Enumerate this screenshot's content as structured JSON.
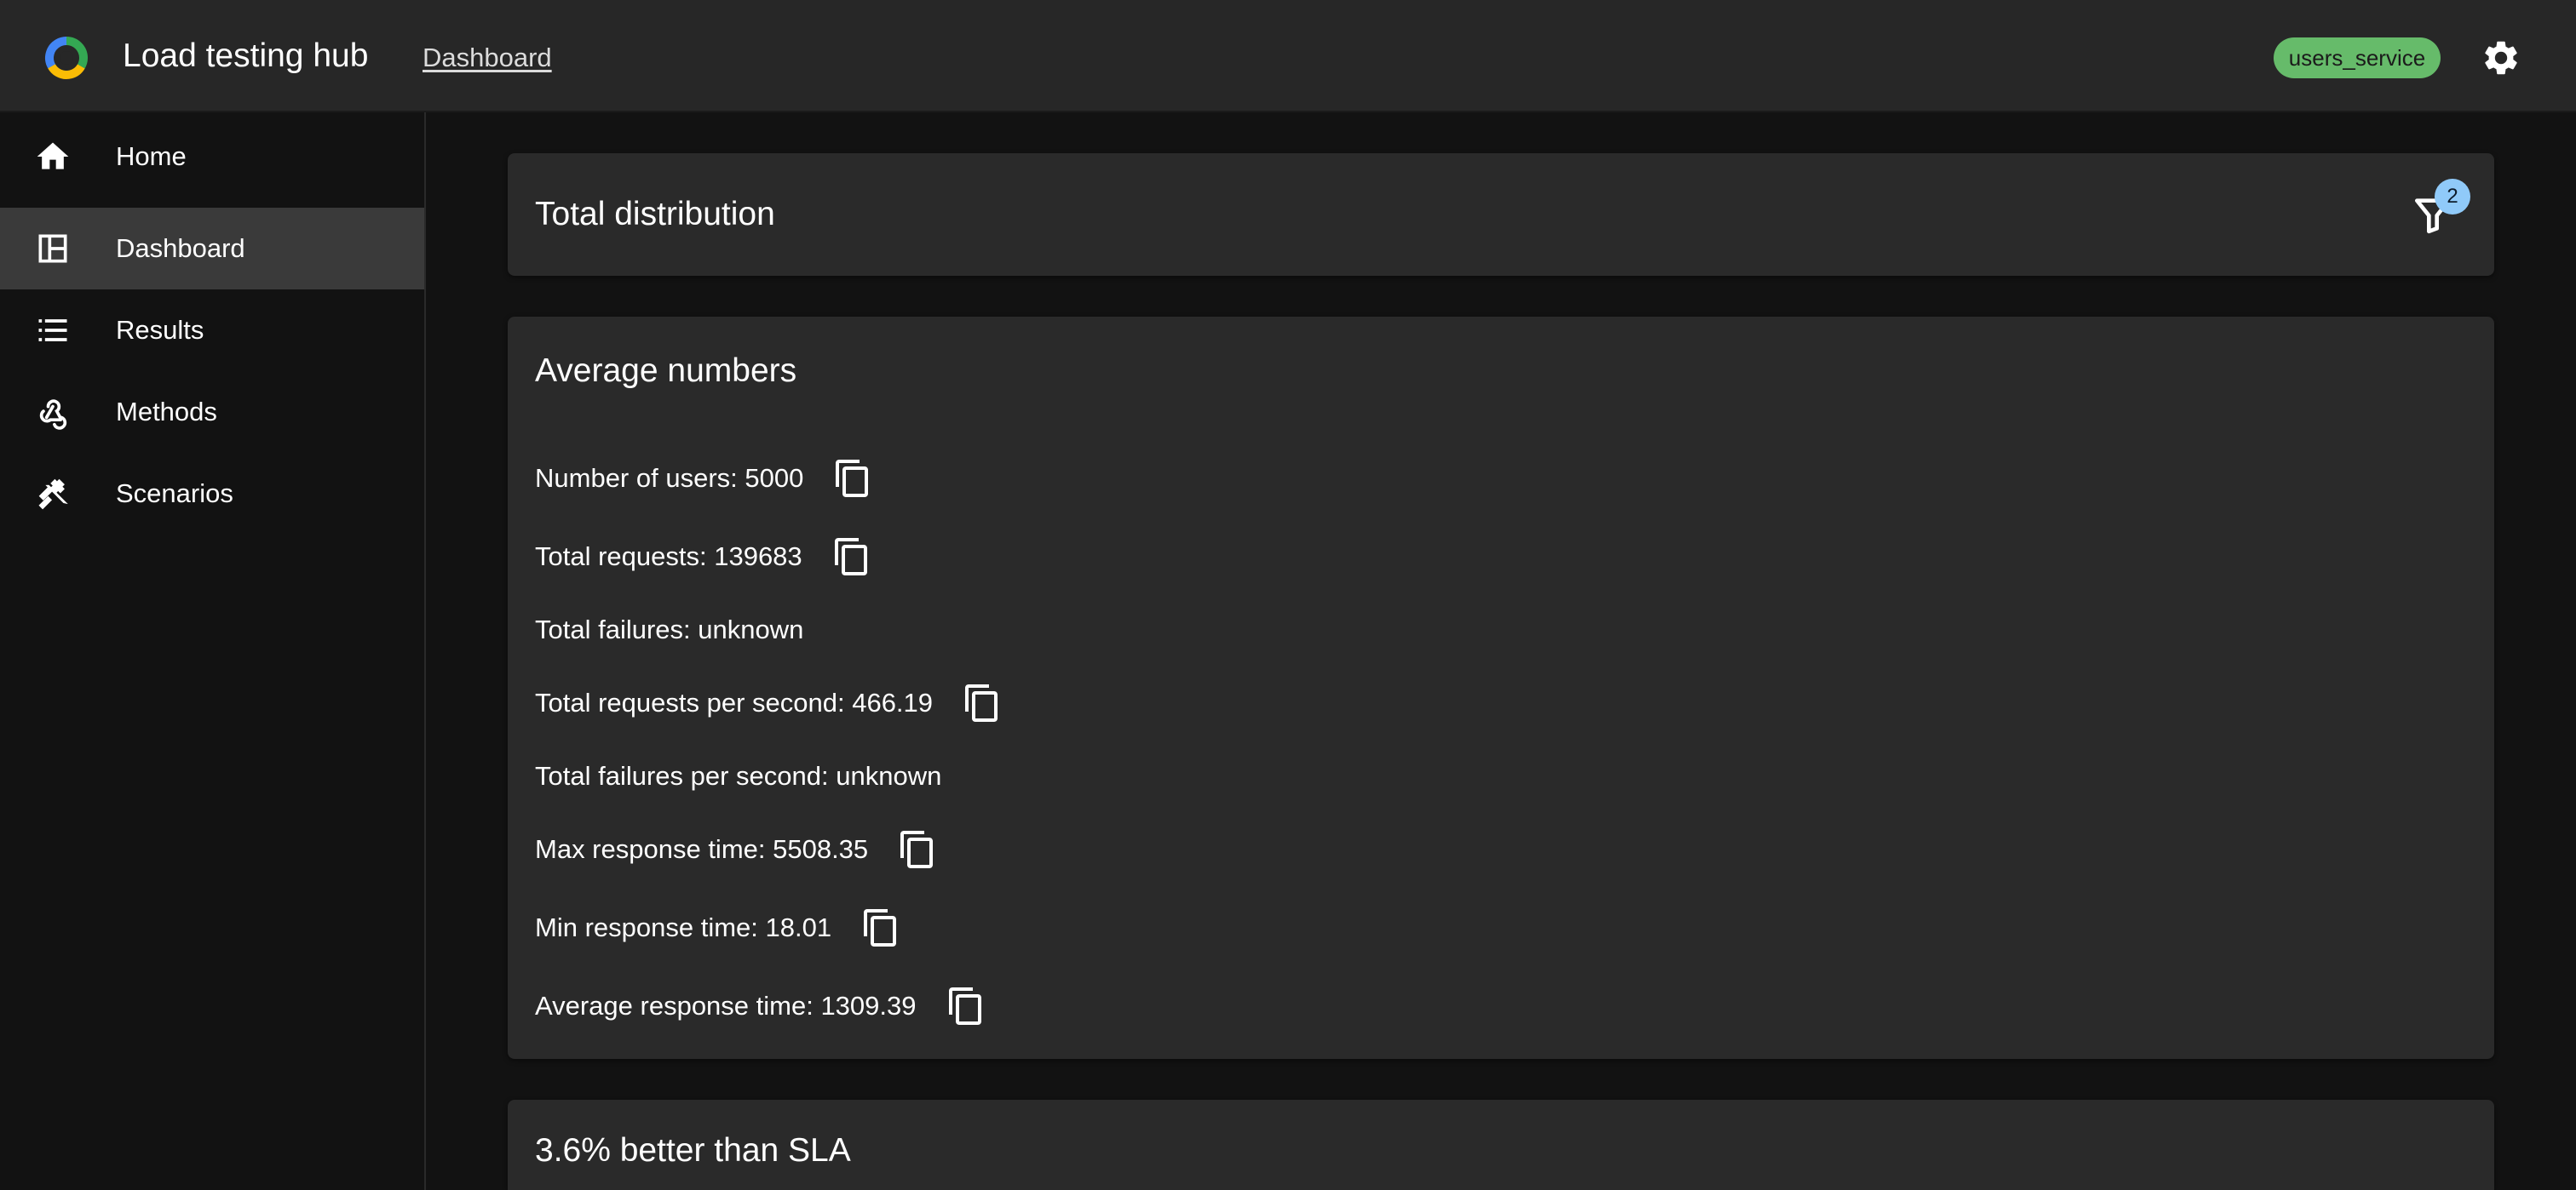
{
  "header": {
    "app_title": "Load testing hub",
    "breadcrumb": "Dashboard",
    "service_badge": "users_service",
    "colors": {
      "badge": "#66bb6a",
      "accent": "#90caf9"
    }
  },
  "sidebar": {
    "items": [
      {
        "label": "Home",
        "icon": "home-icon",
        "active": false
      },
      {
        "label": "Dashboard",
        "icon": "dashboard-icon",
        "active": true
      },
      {
        "label": "Results",
        "icon": "list-icon",
        "active": false
      },
      {
        "label": "Methods",
        "icon": "webhook-icon",
        "active": false
      },
      {
        "label": "Scenarios",
        "icon": "tools-icon",
        "active": false
      }
    ]
  },
  "distribution": {
    "title": "Total distribution",
    "filter_count": "2"
  },
  "average": {
    "title": "Average numbers",
    "stats": [
      {
        "text": "Number of users: 5000",
        "copyable": true
      },
      {
        "text": "Total requests: 139683",
        "copyable": true
      },
      {
        "text": "Total failures: unknown",
        "copyable": false
      },
      {
        "text": "Total requests per second: 466.19",
        "copyable": true
      },
      {
        "text": "Total failures per second: unknown",
        "copyable": false
      },
      {
        "text": "Max response time: 5508.35",
        "copyable": true
      },
      {
        "text": "Min response time: 18.01",
        "copyable": true
      },
      {
        "text": "Average response time: 1309.39",
        "copyable": true
      }
    ]
  },
  "sla": {
    "title": "3.6% better than SLA"
  }
}
